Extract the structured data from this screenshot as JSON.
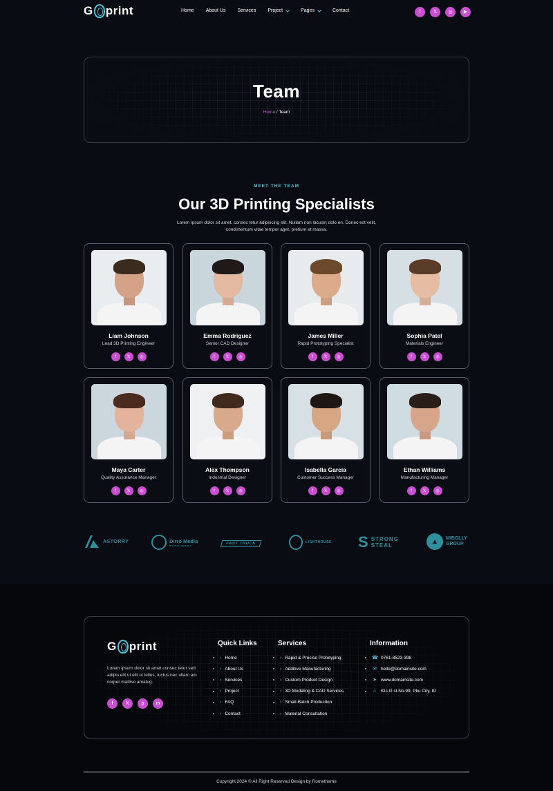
{
  "header": {
    "logo": "Goprint",
    "nav": [
      {
        "label": "Home"
      },
      {
        "label": "About Us"
      },
      {
        "label": "Services"
      },
      {
        "label": "Project"
      },
      {
        "label": "Pages"
      },
      {
        "label": "Contact"
      }
    ],
    "social_icons": [
      "facebook-icon",
      "x-icon",
      "instagram-icon",
      "youtube-icon"
    ]
  },
  "hero": {
    "title": "Team",
    "breadcrumb_home": "Home",
    "breadcrumb_separator": " / ",
    "breadcrumb_current": "Team"
  },
  "team_section": {
    "eyebrow": "MEET THE TEAM",
    "title": "Our 3D Printing Specialists",
    "description": "Lorem ipsum dolor sit amet, consec tetur adipiscing elit. Nullam non lacusin dolo en. Donec est velit, condimentum vitae tempor aget, pretium et massa.",
    "members": [
      {
        "name": "Liam Johnson",
        "role": "Lead 3D Printing Engineer"
      },
      {
        "name": "Emma Rodriguez",
        "role": "Senior CAD Designer"
      },
      {
        "name": "James Miller",
        "role": "Rapid Prototyping Specialist"
      },
      {
        "name": "Sophia Patel",
        "role": "Materials Engineer"
      },
      {
        "name": "Maya Carter",
        "role": "Quality Assurance Manager"
      },
      {
        "name": "Alex Thompson",
        "role": "Industrial Designer"
      },
      {
        "name": "Isabella Garcia",
        "role": "Customer Success Manager"
      },
      {
        "name": "Ethan Williams",
        "role": "Manufacturing Manager"
      }
    ]
  },
  "brands": [
    {
      "name": "ASTORRY"
    },
    {
      "name": "Dirro Media",
      "tagline": "DIGITAL AGENCY"
    },
    {
      "name": "FAST TRUCK"
    },
    {
      "name": "LIGHTHOUSE"
    },
    {
      "name": "STRONG STEAL"
    },
    {
      "name": "MIBOLLY GROUP"
    }
  ],
  "footer": {
    "logo": "Goprint",
    "about": "Lorem ipsum dolor sit amet consec tetur sed adipis elit ut elit ut tellus, luctus nec ullam am corper mattiso amatug.",
    "quick_links_title": "Quick Links",
    "quick_links": [
      "Home",
      "About Us",
      "Services",
      "Project",
      "FAQ",
      "Contact"
    ],
    "services_title": "Services",
    "services": [
      "Rapid & Precise Prototyping",
      "Additive Manufacturing",
      "Custom Product Design",
      "3D Modeling & CAD Services",
      "Small-Batch Production",
      "Material Consultation"
    ],
    "info_title": "Information",
    "info": [
      "0761-8523-398",
      "hello@domainsite.com",
      "www.domainsite.com",
      "KLLG st.No.99, Pku City, ID"
    ],
    "copyright": "Copyright 2024 © All Right Reserved Design by Rometheme"
  },
  "colors": {
    "background": "#0a0c13",
    "accent_pink": "#c94fd0",
    "accent_cyan": "#49c7d9"
  }
}
